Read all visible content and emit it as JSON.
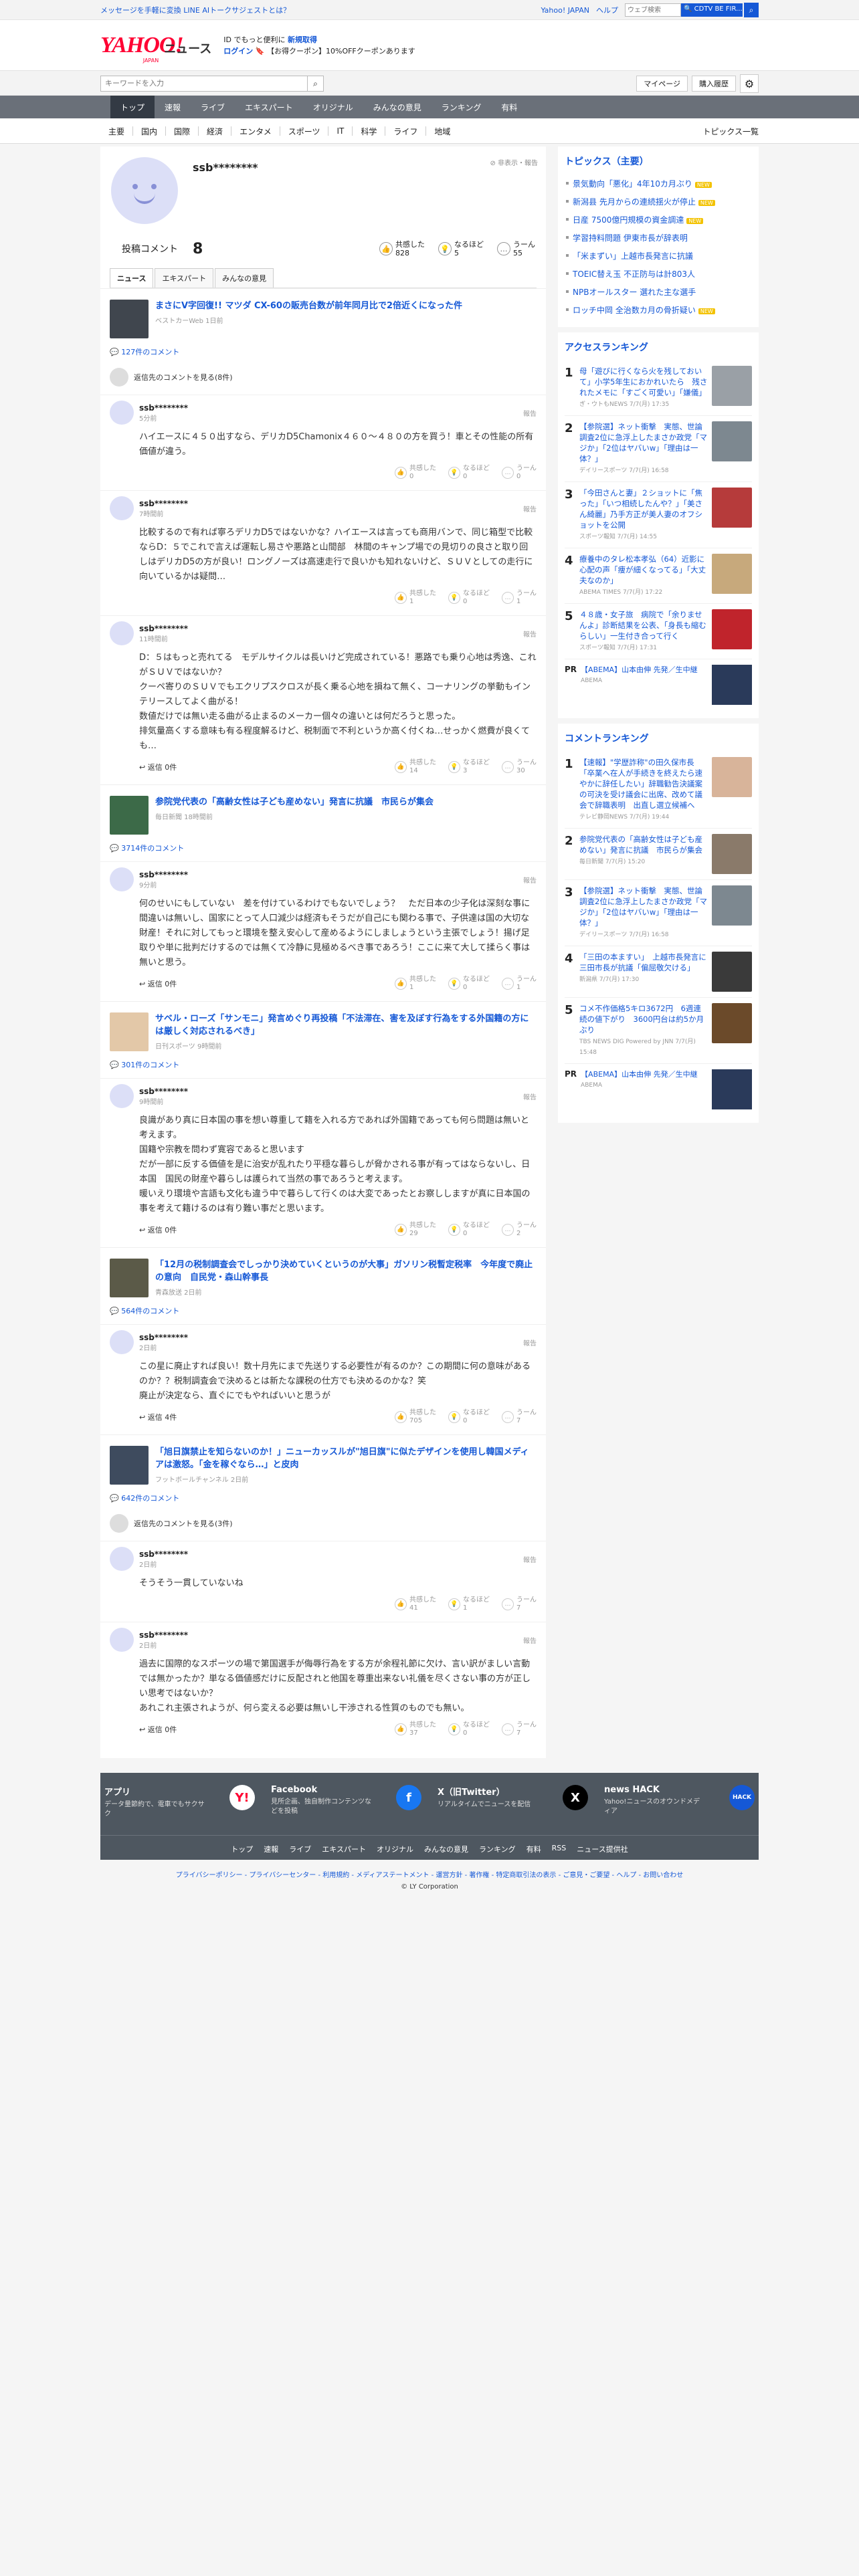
{
  "topbar": {
    "message": "メッセージを手軽に変換 LINE AIトークサジェストとは？",
    "yahoo_japan": "Yahoo! JAPAN",
    "help": "ヘルプ",
    "search_placeholder": "ウェブ検索",
    "search_button": "🔍 CDTV BE FIR..."
  },
  "header": {
    "logo": "YAHOO!",
    "logo_sub": "JAPAN",
    "news": "ニュース",
    "promo1_pre": "ID でもっと便利に",
    "promo1_link": "新規取得",
    "promo2_login": "ログイン",
    "promo2_text": "【お得クーポン】10%OFFクーポンあります"
  },
  "search": {
    "placeholder": "キーワードを入力",
    "mypage": "マイページ",
    "purchase": "購入履歴"
  },
  "gnav": [
    "トップ",
    "速報",
    "ライブ",
    "エキスパート",
    "オリジナル",
    "みんなの意見",
    "ランキング",
    "有料"
  ],
  "snav": [
    "主要",
    "国内",
    "国際",
    "経済",
    "エンタメ",
    "スポーツ",
    "IT",
    "科学",
    "ライフ",
    "地域"
  ],
  "snav_right": "トピックス一覧",
  "profile": {
    "name": "ssb********",
    "report": "非表示・報告",
    "comments_label": "投稿コメント",
    "comments_count": "8",
    "reactions": [
      {
        "label": "共感した",
        "value": "828"
      },
      {
        "label": "なるほど",
        "value": "5"
      },
      {
        "label": "うーん",
        "value": "55"
      }
    ]
  },
  "tabs": [
    "ニュース",
    "エキスパート",
    "みんなの意見"
  ],
  "articles": [
    {
      "title": "まさにV字回復!! マツダ CX-60の販売台数が前年同月比で2倍近くになった件",
      "source": "ベストカーWeb 1日前",
      "count": "127件のコメント",
      "more": "返信先のコメントを見る(8件)",
      "comments": [
        {
          "name": "ssb********",
          "time": "5分前",
          "body": "ハイエースに４５０出すなら、デリカD5Chamonix４６０〜４８０の方を買う！車とその性能の所有価値が違う。",
          "reply": "",
          "r": [
            "0",
            "0",
            "0"
          ]
        },
        {
          "name": "ssb********",
          "time": "7時間前",
          "body": "比較するので有れば寧ろデリカD5ではないかな？ハイエースは言っても商用バンで、同じ箱型で比較ならD：５でこれで言えば運転し易さや悪路と山間部　林間のキャンプ場での見切りの良さと取り回しはデリカD5の方が良い！ロングノーズは高速走行で良いかも知れないけど、ＳＵＶとしての走行に向いているかは疑問…",
          "reply": "",
          "r": [
            "1",
            "0",
            "1"
          ]
        },
        {
          "name": "ssb********",
          "time": "11時間前",
          "body": "D：５はもっと売れてる　モデルサイクルは長いけど完成されている！悪路でも乗り心地は秀逸、これがＳＵＶではないか？\nクーペ寄りのＳＵＶでもエクリプスクロスが長く乗る心地を損ねて無く、コーナリングの挙動もインテリースしてよく曲がる！\n数値だけでは無い走る曲がる止まるのメーカー個々の違いとは何だろうと思った。\n排気量高くする意味も有る程度解るけど、税制面で不利というか高く付くね…せっかく燃費が良くても…",
          "reply": "返信 0件",
          "r": [
            "14",
            "3",
            "30"
          ]
        }
      ]
    },
    {
      "title": "参院党代表の「高齢女性は子ども産めない」発言に抗議　市民らが集会",
      "source": "毎日新聞 18時間前",
      "count": "3714件のコメント",
      "more": "",
      "comments": [
        {
          "name": "ssb********",
          "time": "9分前",
          "body": "何のせいにもしていない　差を付けているわけでもないでしょう？　ただ日本の少子化は深刻な事に間違いは無いし、国家にとって人口減少は経済もそうだが自己にも関わる事で、子供達は国の大切な財産！それに対してもっと環境を整え安心して産めるようにしましょうという主張でしょう！揚げ足取りや単に批判だけするのでは無くて冷静に見極めるべき事であろう！ここに来て大して揉らく事は無いと思う。",
          "reply": "返信 0件",
          "r": [
            "1",
            "0",
            "1"
          ]
        }
      ]
    },
    {
      "title": "サベル・ローズ「サンモニ」発言めぐり再投稿「不法滞在、害を及ぼす行為をする外国籍の方には厳しく対応されるべき」",
      "source": "日刊スポーツ 9時間前",
      "count": "301件のコメント",
      "more": "",
      "comments": [
        {
          "name": "ssb********",
          "time": "9時間前",
          "body": "良識があり真に日本国の事を想い尊重して籍を入れる方であれば外国籍であっても何ら問題は無いと考えます。\n国籍や宗教を問わず寛容であると思います\nだが一部に反する価値を是に治安が乱れたり平穏な暮らしが脅かされる事が有ってはならないし、日本国　国民の財産や暮らしは護られて当然の事であろうと考えます。\n暖いえり環境や言語も文化も違う中で暮らして行くのは大変であったとお察ししますが真に日本国の事を考えて籍けるのは有り難い事だと思います。",
          "reply": "返信 0件",
          "r": [
            "29",
            "0",
            "2"
          ]
        }
      ]
    },
    {
      "title": "「12月の税制調査会でしっかり決めていくというのが大事」ガソリン税暫定税率　今年度で廃止の意向　自民党・森山幹事長",
      "source": "青森放送 2日前",
      "count": "564件のコメント",
      "more": "",
      "comments": [
        {
          "name": "ssb********",
          "time": "2日前",
          "body": "この星に廃止すれば良い！数十月先にまで先送りする必要性が有るのか？この期間に何の意味があるのか？？税制調査会で決めるとは新たな課税の仕方でも決めるのかな？笑\n廃止が決定なら、直ぐにでもやればいいと思うが",
          "reply": "返信 4件",
          "r": [
            "705",
            "0",
            "7"
          ]
        }
      ]
    },
    {
      "title": "「旭日旗禁止を知らないのか！」ニューカッスルが\"旭日旗\"に似たデザインを使用し韓国メディアは激怒。「金を稼ぐなら…」と皮肉",
      "source": "フットボールチャンネル 2日前",
      "count": "642件のコメント",
      "more": "返信先のコメントを見る(3件)",
      "comments": [
        {
          "name": "ssb********",
          "time": "2日前",
          "body": "そうそう一貫していないね",
          "reply": "",
          "r": [
            "41",
            "1",
            "7"
          ]
        },
        {
          "name": "ssb********",
          "time": "2日前",
          "body": "過去に国際的なスポーツの場で第国選手が侮辱行為をする方が余程礼節に欠け、言い訳がましい言動では無かったか？単なる価値感だけに反配されと他国を尊重出来ない礼儀を尽くさない事の方が正しい思考ではないか？\nあれこれ主張されようが、何ら変える必要は無いし干渉される性質のものでも無い。",
          "reply": "返信 0件",
          "r": [
            "37",
            "0",
            "7"
          ]
        }
      ]
    }
  ],
  "topics": {
    "title": "トピックス（主要）",
    "items": [
      {
        "t": "景気動向「悪化」4年10カ月ぶり",
        "n": "NEW"
      },
      {
        "t": "新潟县 先月からの連続揺火が停止",
        "n": "NEW"
      },
      {
        "t": "日産 7500億円規模の資金調達",
        "n": "NEW"
      },
      {
        "t": "学習持料問題 伊東市長が辞表明",
        "n": ""
      },
      {
        "t": "「米まずい」上越市長発言に抗議",
        "n": ""
      },
      {
        "t": "TOEIC替え玉 不正防与は計803人",
        "n": ""
      },
      {
        "t": "NPBオールスター 選れた主な選手",
        "n": ""
      },
      {
        "t": "ロッチ中岡 全治数カ月の骨折疑い",
        "n": "NEW"
      }
    ]
  },
  "access": {
    "title": "アクセスランキング",
    "items": [
      {
        "n": "1",
        "t": "母「遊びに行くなら火を残しておいて」小学5年生におかれいたら　残されたメモに「すごく可愛い」「嫌儀」",
        "m": "ぎ・ウトもNEWS 7/7(月) 17:35",
        "c": "#9aa0a6"
      },
      {
        "n": "2",
        "t": "【参院選】ネット衝撃　実態、世論調査2位に急浮上したまさか政党「マジか」「2位はヤバいw」「理由は一体？」",
        "m": "デイリースポーツ 7/7(月) 16:58",
        "c": "#7d8890"
      },
      {
        "n": "3",
        "t": "「今田さんと妻」２ショットに「焦った」「いつ相続したんや？」「美さん綺麗」乃手方正が美人妻のオフショットを公開",
        "m": "スポーツ報知 7/7(月) 14:55",
        "c": "#b63b3b"
      },
      {
        "n": "4",
        "t": "療養中のタレ松本孝弘（64）近影に心配の声「痩が細くなってる」「大丈夫なのか」",
        "m": "ABEMA TIMES 7/7(月) 17:22",
        "c": "#c7a97c"
      },
      {
        "n": "5",
        "t": "４８歳・女子旅　病院で「余りませんよ」診断結果を公表、「身長も縮むらしい」一生付き合って行く",
        "m": "スポーツ報知 7/7(月) 17:31",
        "c": "#c0242c"
      }
    ],
    "pr": {
      "t": "【ABEMA】山本由伸 先発／生中継",
      "m": "ABEMA"
    }
  },
  "comment_rank": {
    "title": "コメントランキング",
    "items": [
      {
        "n": "1",
        "t": "【速報】\"学歴詐称\"の田久保市長「卒業へ在人が手続きを終えたら速やかに辞任したい」辞職勧告決議案の可決を受け議会に出席、改めて議会で辞職表明　出直し選立候補へ",
        "m": "テレビ静岡NEWS 7/7(月) 19:44",
        "c": "#d8b49a"
      },
      {
        "n": "2",
        "t": "参院党代表の「高齢女性は子ども産めない」発言に抗議　市民らが集会",
        "m": "毎日新聞 7/7(月) 15:20",
        "c": "#8a7a6a"
      },
      {
        "n": "3",
        "t": "【参院選】ネット衝撃　実態、世論調査2位に急浮上したまさか政党「マジか」「2位はヤバいw」「理由は一体？」",
        "m": "デイリースポーツ 7/7(月) 16:58",
        "c": "#7d8890"
      },
      {
        "n": "4",
        "t": "「三田の本ますい」　上越市長発言に三田市長が抗議「偏屈敬欠ける」",
        "m": "新潟県 7/7(月) 17:30",
        "c": "#3a3a3a"
      },
      {
        "n": "5",
        "t": "コメ不作価格5キロ3672円　6週連続の値下がり　3600円台は約5か月ぶり",
        "m": "TBS NEWS DIG Powered by JNN 7/7(月) 15:48",
        "c": "#6b4a2a"
      }
    ],
    "pr": {
      "t": "【ABEMA】山本由伸 先発／生中継",
      "m": "ABEMA"
    }
  },
  "footer": {
    "cards": [
      {
        "title": "アプリ",
        "desc": "データ量節約で、電車でもサクサク",
        "icon": "Y!"
      },
      {
        "title": "Facebook",
        "desc": "見所企画、独自制作コンテンツなどを投稿",
        "icon": "f"
      },
      {
        "title": "X（旧Twitter）",
        "desc": "リアルタイムでニュースを配信",
        "icon": "X"
      },
      {
        "title": "news HACK",
        "desc": "Yahoo!ニュースのオウンドメディア",
        "icon": "HACK"
      }
    ],
    "links": [
      "トップ",
      "速報",
      "ライブ",
      "エキスパート",
      "オリジナル",
      "みんなの意見",
      "ランキング",
      "有料",
      "RSS",
      "ニュース提供社"
    ],
    "legal": "プライバシーポリシー - プライバシーセンター - 利用規約 - メディアステートメント - 運営方針 - 著作権 - 特定商取引法の表示 - ご意見・ご要望 - ヘルプ - お問い合わせ",
    "copyright": "© LY Corporation"
  }
}
